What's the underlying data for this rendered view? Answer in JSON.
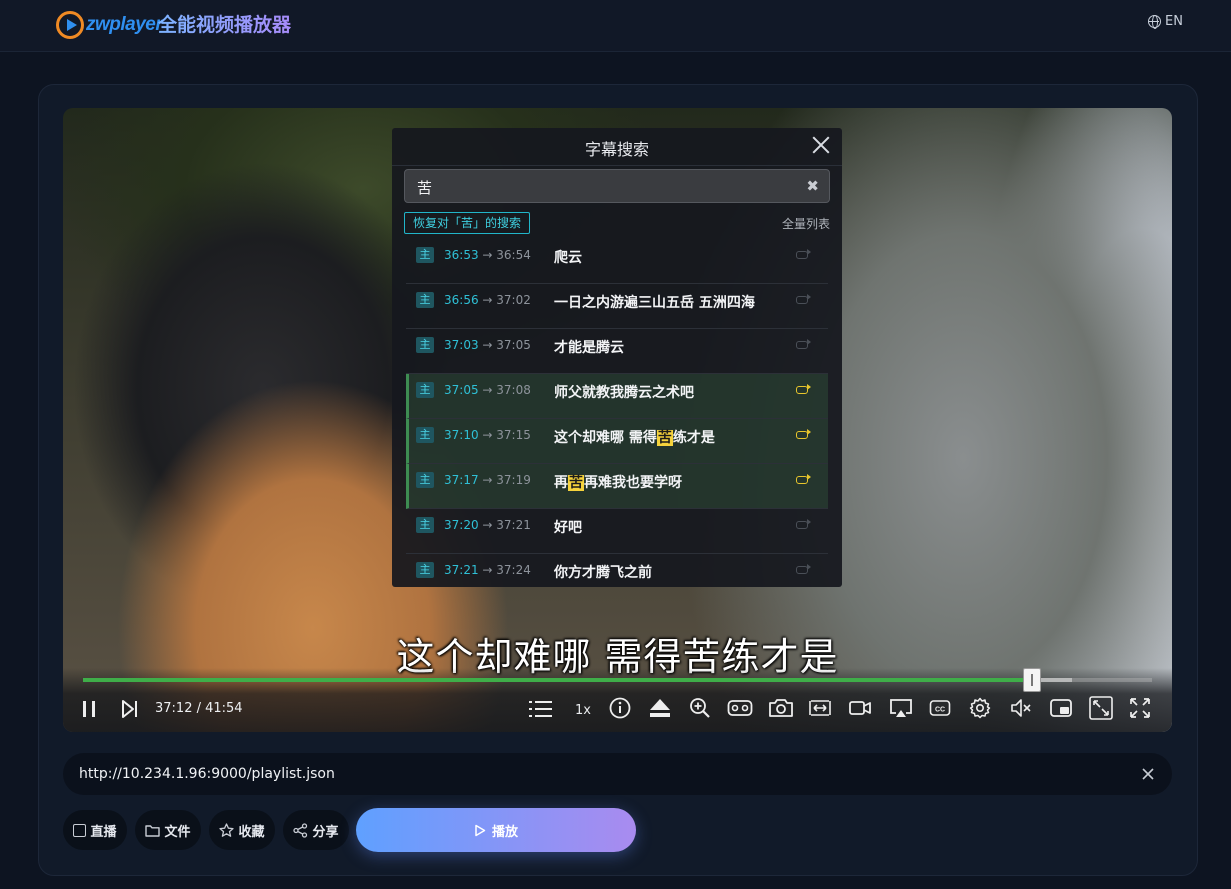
{
  "header": {
    "logo_text": "zwplayer",
    "app_title": "全能视频播放器",
    "lang_label": "EN"
  },
  "video": {
    "subtitle": "这个却难哪 需得苦练才是",
    "current_time": "37:12",
    "duration": "41:54",
    "time_display": "37:12 / 41:54",
    "progress_fraction": 0.888,
    "buffered_fraction": 0.925,
    "speed": "1x"
  },
  "subtitle_search": {
    "title": "字幕搜索",
    "query": "苦",
    "restore_label": "恢复对「苦」的搜索",
    "full_list_label": "全量列表",
    "rows": [
      {
        "tag": "主",
        "start": "36:53",
        "end": "36:54",
        "pre": "爬云",
        "hit": "",
        "post": "",
        "match": false
      },
      {
        "tag": "主",
        "start": "36:56",
        "end": "37:02",
        "pre": "一日之内游遍三山五岳 五洲四海",
        "hit": "",
        "post": "",
        "match": false
      },
      {
        "tag": "主",
        "start": "37:03",
        "end": "37:05",
        "pre": "才能是腾云",
        "hit": "",
        "post": "",
        "match": false
      },
      {
        "tag": "主",
        "start": "37:05",
        "end": "37:08",
        "pre": "师父就教我腾云之术吧",
        "hit": "",
        "post": "",
        "match": true
      },
      {
        "tag": "主",
        "start": "37:10",
        "end": "37:15",
        "pre": "这个却难哪 需得",
        "hit": "苦",
        "post": "练才是",
        "match": true
      },
      {
        "tag": "主",
        "start": "37:17",
        "end": "37:19",
        "pre": "再",
        "hit": "苦",
        "post": "再难我也要学呀",
        "match": true
      },
      {
        "tag": "主",
        "start": "37:20",
        "end": "37:21",
        "pre": "好吧",
        "hit": "",
        "post": "",
        "match": false
      },
      {
        "tag": "主",
        "start": "37:21",
        "end": "37:24",
        "pre": "你方才腾飞之前",
        "hit": "",
        "post": "",
        "match": false
      }
    ]
  },
  "url_bar": {
    "value": "http://10.234.1.96:9000/playlist.json"
  },
  "actions": {
    "live_label": "直播",
    "file_label": "文件",
    "favorite_label": "收藏",
    "share_label": "分享",
    "play_label": "播放"
  },
  "colors": {
    "accent_green": "#3fae49",
    "highlight": "#f6d33c",
    "cyan": "#2fc0d6",
    "play_gradient_start": "#5fa0ff",
    "play_gradient_end": "#a98bef"
  }
}
